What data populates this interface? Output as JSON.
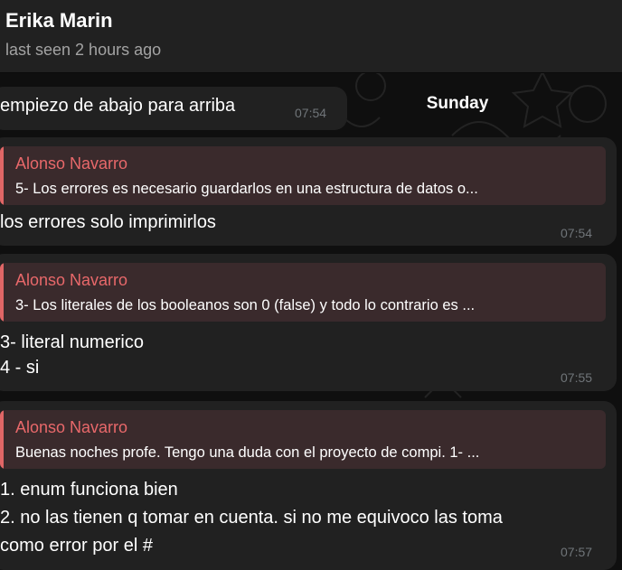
{
  "header": {
    "contact_name": "Erika Marin",
    "status": "last seen 2 hours ago"
  },
  "date_separator": "Sunday",
  "messages": [
    {
      "lines": [
        "empiezo de abajo para arriba"
      ],
      "time": "07:54"
    },
    {
      "reply": {
        "author": "Alonso Navarro",
        "text": "5- Los errores es necesario guardarlos en una estructura de datos o..."
      },
      "lines": [
        "los errores solo imprimirlos"
      ],
      "time": "07:54"
    },
    {
      "reply": {
        "author": "Alonso Navarro",
        "text": "3- Los literales de los booleanos son 0 (false) y todo lo contrario es ..."
      },
      "lines": [
        "3- literal numerico",
        "4 - si"
      ],
      "time": "07:55"
    },
    {
      "reply": {
        "author": "Alonso Navarro",
        "text": "Buenas noches profe. Tengo una duda con el proyecto de compi. 1- ..."
      },
      "lines": [
        "1. enum funciona bien",
        "2. no las tienen q tomar en cuenta. si no me equivoco las toma",
        "como error por el #"
      ],
      "time": "07:57"
    }
  ]
}
